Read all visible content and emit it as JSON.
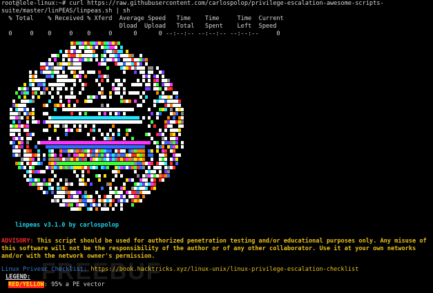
{
  "terminal": {
    "prompt_command": "root@lele-linux:~# curl https://raw.githubusercontent.com/carlospolop/privilege-escalation-awesome-scripts-suite/master/linPEAS/linpeas.sh | sh",
    "curl_header_1": "  % Total    % Received % Xferd  Average Speed   Time    Time     Time  Current",
    "curl_header_2": "                                 Dload  Upload   Total   Spent    Left  Speed",
    "curl_progress": "  0     0    0     0    0     0      0      0 --:--:-- --:--:-- --:--:--     0"
  },
  "banner": {
    "caption": "linpeas v3.1.0 by carlospolop",
    "palette": [
      "#ff2a2a",
      "#ffe300",
      "#39ff39",
      "#ff33ff",
      "#22e6ff",
      "#2f6bff",
      "#ffffff",
      "#8a8a8a",
      "#ff7f00",
      "#7a3cff"
    ]
  },
  "advisory": {
    "label": "ADVISORY:",
    "text": " This script should be used for authorized penetration testing and/or educational purposes only. Any misuse of this software will not be the responsibility of the author or of any other collaborator. Use it at your own networks and/or with the network owner's permission."
  },
  "checklist": {
    "label": "Linux Privesc Checklist:",
    "url": " https://book.hacktricks.xyz/linux-unix/linux-privilege-escalation-checklist"
  },
  "legend": {
    "title": "LEGEND:",
    "tag": "RED/YELLOW",
    "description": ": 95% a PE vector"
  },
  "watermark": "FREEBUF"
}
